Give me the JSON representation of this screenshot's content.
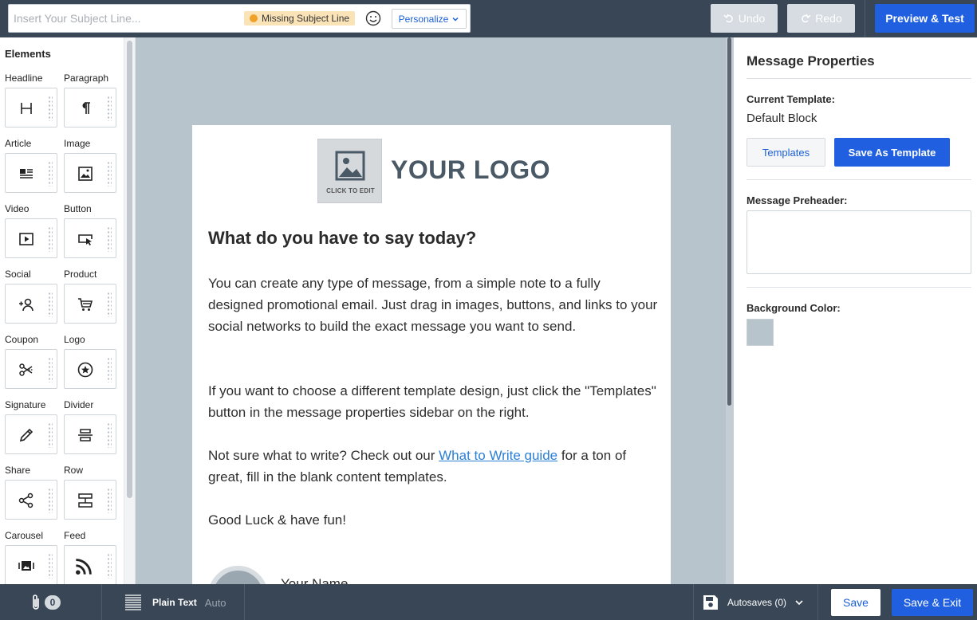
{
  "header": {
    "subject_placeholder": "Insert Your Subject Line...",
    "missing_badge": "Missing Subject Line",
    "personalize_label": "Personalize",
    "undo_label": "Undo",
    "redo_label": "Redo",
    "preview_label": "Preview & Test"
  },
  "elements_panel": {
    "title": "Elements",
    "items": [
      {
        "label": "Headline",
        "icon": "headline-icon"
      },
      {
        "label": "Paragraph",
        "icon": "paragraph-icon"
      },
      {
        "label": "Article",
        "icon": "article-icon"
      },
      {
        "label": "Image",
        "icon": "image-icon"
      },
      {
        "label": "Video",
        "icon": "video-icon"
      },
      {
        "label": "Button",
        "icon": "button-icon"
      },
      {
        "label": "Social",
        "icon": "social-icon"
      },
      {
        "label": "Product",
        "icon": "cart-icon"
      },
      {
        "label": "Coupon",
        "icon": "scissors-icon"
      },
      {
        "label": "Logo",
        "icon": "logo-icon"
      },
      {
        "label": "Signature",
        "icon": "pen-icon"
      },
      {
        "label": "Divider",
        "icon": "divider-icon"
      },
      {
        "label": "Share",
        "icon": "share-icon"
      },
      {
        "label": "Row",
        "icon": "row-icon"
      },
      {
        "label": "Carousel",
        "icon": "carousel-icon"
      },
      {
        "label": "Feed",
        "icon": "rss-icon"
      }
    ]
  },
  "email": {
    "logo_placeholder_text": "CLICK TO EDIT",
    "logo_text": "YOUR LOGO",
    "heading": "What do you have to say today?",
    "p1": "You can create any type of message, from a simple note to a fully designed promotional email. Just drag in images, buttons, and links to your social networks to build the exact message you want to send.",
    "p2": "If you want to choose a different template design, just click the \"Templates\" button in the message properties sidebar on the right.",
    "p3_before": "Not sure what to write? Check out our ",
    "p3_link": "What to Write guide",
    "p3_after": " for a ton of great, fill in the blank content templates.",
    "p4": "Good Luck & have fun!",
    "signature_name": "Your Name"
  },
  "properties": {
    "title": "Message Properties",
    "current_template_label": "Current Template:",
    "current_template_value": "Default Block",
    "templates_button": "Templates",
    "save_as_template_button": "Save As Template",
    "preheader_label": "Message Preheader:",
    "preheader_value": "",
    "background_color_label": "Background Color:",
    "background_color": "#b8c4cb"
  },
  "footer": {
    "attachment_count": "0",
    "plain_text_label": "Plain Text",
    "plain_text_mode": "Auto",
    "autosaves_label": "Autosaves (0)",
    "save_label": "Save",
    "save_exit_label": "Save & Exit"
  },
  "colors": {
    "topbar": "#394656",
    "primary": "#1f5fe0",
    "link": "#2a7fd6",
    "canvas_bg": "#b8c4cb",
    "warning": "#f0a12a"
  }
}
